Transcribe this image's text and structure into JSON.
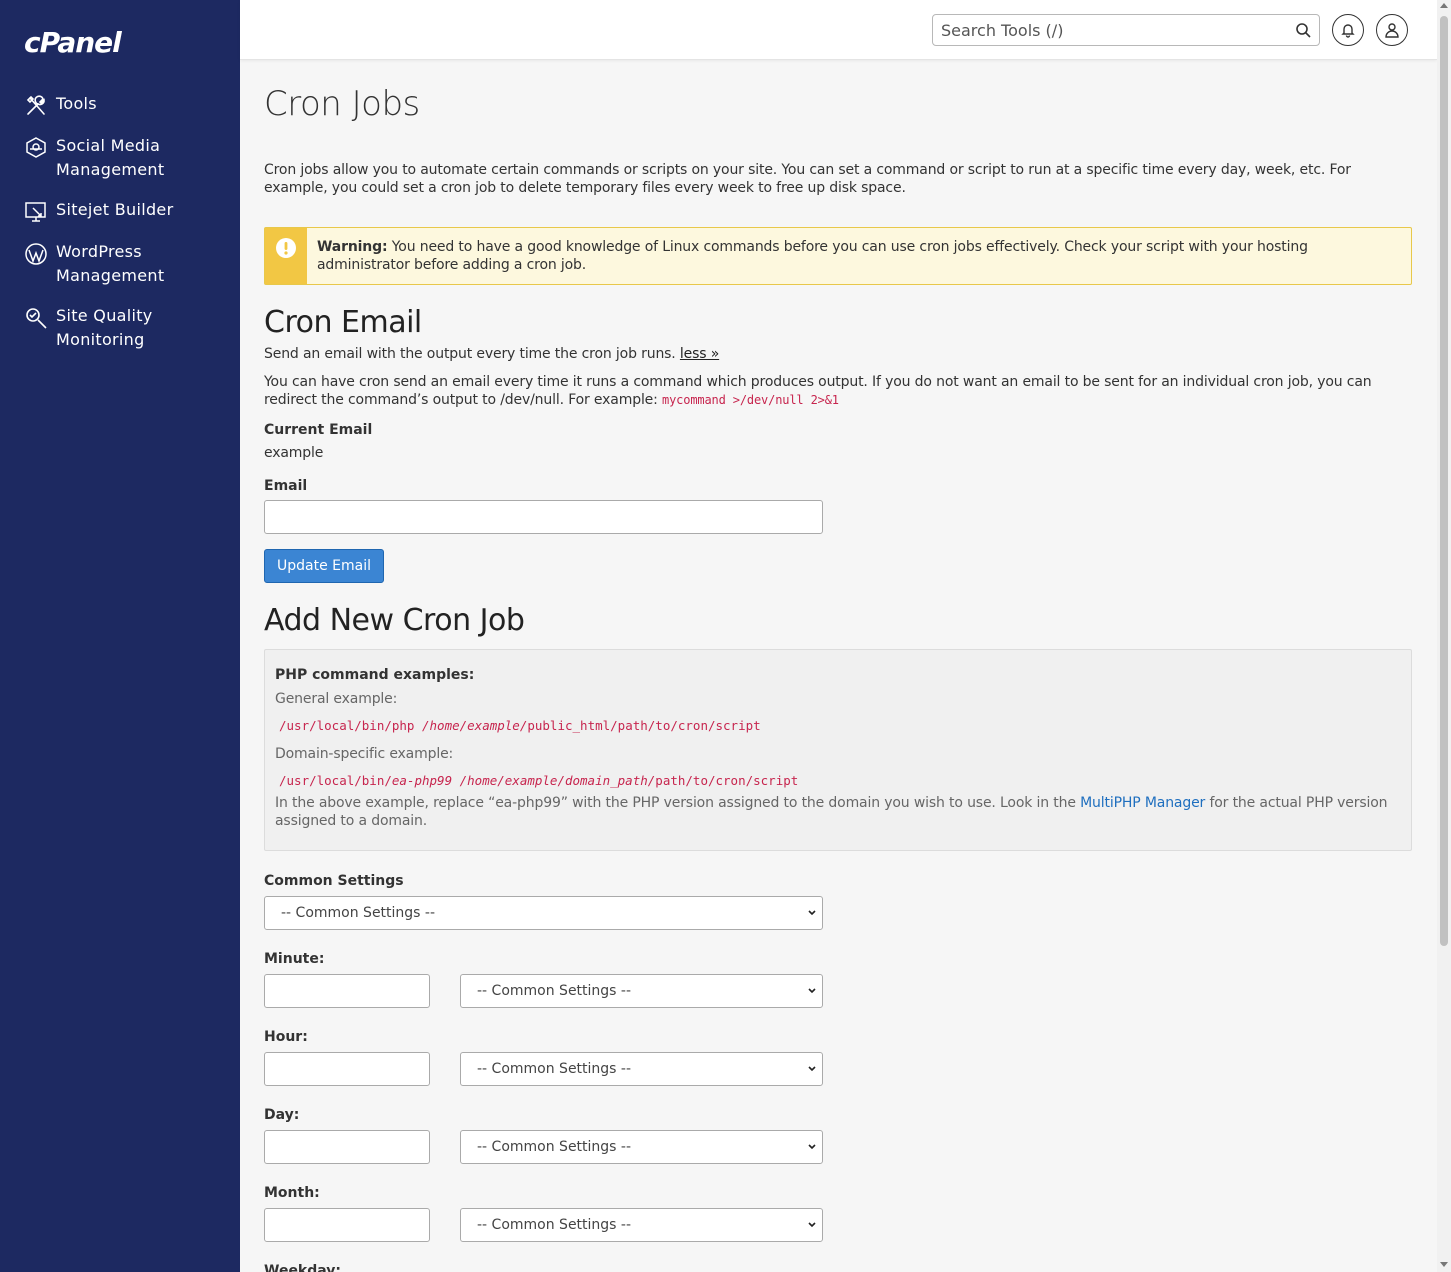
{
  "sidebar": {
    "logo": "cPanel",
    "items": [
      {
        "label": "Tools"
      },
      {
        "label": "Social Media\nManagement"
      },
      {
        "label": "Sitejet Builder"
      },
      {
        "label": "WordPress\nManagement"
      },
      {
        "label": "Site Quality\nMonitoring"
      }
    ]
  },
  "header": {
    "search_placeholder": "Search Tools (/)"
  },
  "page": {
    "title": "Cron Jobs",
    "intro": "Cron jobs allow you to automate certain commands or scripts on your site. You can set a command or script to run at a specific time every day, week, etc. For example, you could set a cron job to delete temporary files every week to free up disk space.",
    "warning_label": "Warning:",
    "warning_text": " You need to have a good knowledge of Linux commands before you can use cron jobs effectively. Check your script with your hosting administrator before adding a cron job."
  },
  "cron_email": {
    "heading": "Cron Email",
    "desc": "Send an email with the output every time the cron job runs. ",
    "less_link": "less »",
    "long_desc": "You can have cron send an email every time it runs a command which produces output. If you do not want an email to be sent for an individual cron job, you can redirect the command’s output to /dev/null. For example: ",
    "example_code": "mycommand >/dev/null 2>&1",
    "current_email_label": "Current Email",
    "current_email_value": "example",
    "email_label": "Email",
    "email_value": "",
    "update_button": "Update Email"
  },
  "add_cron": {
    "heading": "Add New Cron Job",
    "php_examples_label": "PHP command examples:",
    "general_label": "General example:",
    "general_code_a": "/usr/local/bin/php ",
    "general_code_b": "/home/example/",
    "general_code_c": "public_html/path/to/cron/script",
    "domain_label": "Domain-specific example:",
    "domain_code_a": "/usr/local/bin/",
    "domain_code_b": "ea-php99 /home/example/domain_path/",
    "domain_code_c": "path/to/cron/script",
    "note_a": "In the above example, replace “ea-php99” with the PHP version assigned to the domain you wish to use. Look in the ",
    "note_link": "MultiPHP Manager",
    "note_b": " for the actual PHP version assigned to a domain.",
    "common_settings_label": "Common Settings",
    "select_default": "-- Common Settings --",
    "minute_label": "Minute:",
    "hour_label": "Hour:",
    "day_label": "Day:",
    "month_label": "Month:",
    "weekday_label": "Weekday:"
  }
}
